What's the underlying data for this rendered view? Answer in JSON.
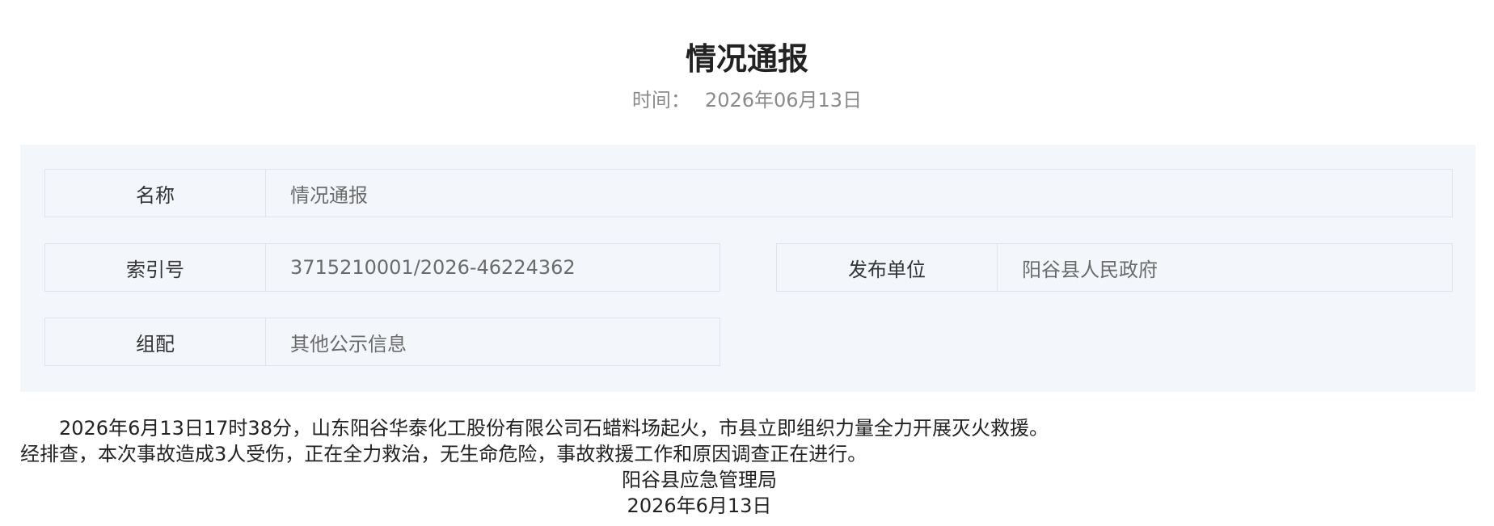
{
  "article": {
    "title": "情况通报",
    "date_label": "时间：",
    "date_value": "2026年06月13日"
  },
  "meta": {
    "name": {
      "label": "名称",
      "value": "情况通报"
    },
    "index_no": {
      "label": "索引号",
      "value": "3715210001/2026-46224362"
    },
    "publisher": {
      "label": "发布单位",
      "value": "阳谷县人民政府"
    },
    "category": {
      "label": "组配",
      "value": "其他公示信息"
    }
  },
  "content": {
    "paragraph1": "2026年6月13日17时38分，山东阳谷华泰化工股份有限公司石蜡料场起火，市县立即组织力量全力开展灭火救援。",
    "paragraph2": "经排查，本次事故造成3人受伤，正在全力救治，无生命危险，事故救援工作和原因调查正在进行。",
    "signature": "阳谷县应急管理局",
    "sign_date": "2026年6月13日"
  }
}
